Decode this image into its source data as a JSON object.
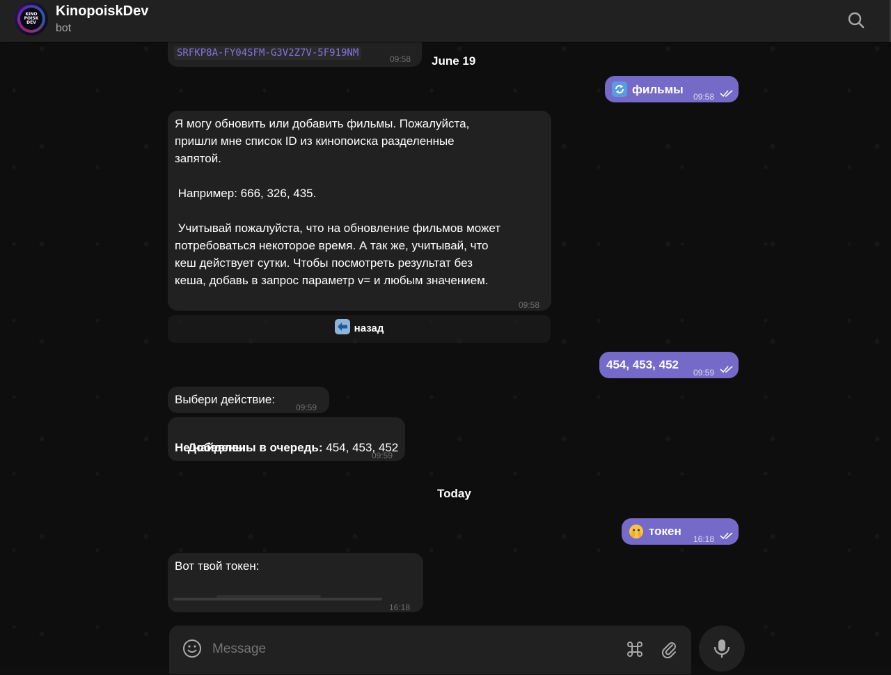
{
  "header": {
    "title": "KinopoiskDev",
    "subtitle": "bot",
    "avatar_logo": "KINO POISK DEV"
  },
  "messages": {
    "code_message": {
      "code": "SRFKP8A-FY04SFM-G3V2Z7V-5F919NM",
      "time": "09:58"
    },
    "date_june": "June 19",
    "out_films": {
      "emoji": "🔄",
      "text": "фильмы",
      "time": "09:58"
    },
    "bot_info": {
      "lines": [
        "Я могу обновить или добавить фильмы. Пожалуйста,",
        "пришли мне список ID из кинопоиска разделенные",
        "запятой.",
        "",
        " Например: 666, 326, 435.",
        "",
        " Учитывай пожалуйста, что на обновление фильмов может",
        "потребоваться некоторое время. А так же, учитывай, что",
        "кеш действует сутки. Чтобы посмотреть результат без",
        "кеша, добавь в запрос параметр v= и любым значением."
      ],
      "time": "09:58"
    },
    "back_button": {
      "emoji": "⬅",
      "label": "назад"
    },
    "out_ids": {
      "text": "454, 453, 452",
      "time": "09:59"
    },
    "bot_choose": {
      "text": "Выбери действие:",
      "time": "09:59"
    },
    "bot_queued": {
      "label1": "Добавлены в очередь:",
      "value1": " 454, 453, 452",
      "label2": "Не найдены:",
      "time": "09:59"
    },
    "date_today": "Today",
    "out_token": {
      "emoji": "🫣",
      "text": "токен",
      "time": "16:18"
    },
    "bot_token": {
      "text": "Вот твой токен:",
      "time": "16:18"
    }
  },
  "composer": {
    "placeholder": "Message"
  },
  "icons": {
    "search": "search-icon",
    "emoji": "smile-icon",
    "commands": "command-icon",
    "attach": "paperclip-icon",
    "mic": "microphone-icon",
    "read": "double-check-icon"
  },
  "colors": {
    "outgoing_bubble": "#766ac8",
    "incoming_bubble": "#212121",
    "header": "#212121",
    "code_text": "#8774e1"
  }
}
